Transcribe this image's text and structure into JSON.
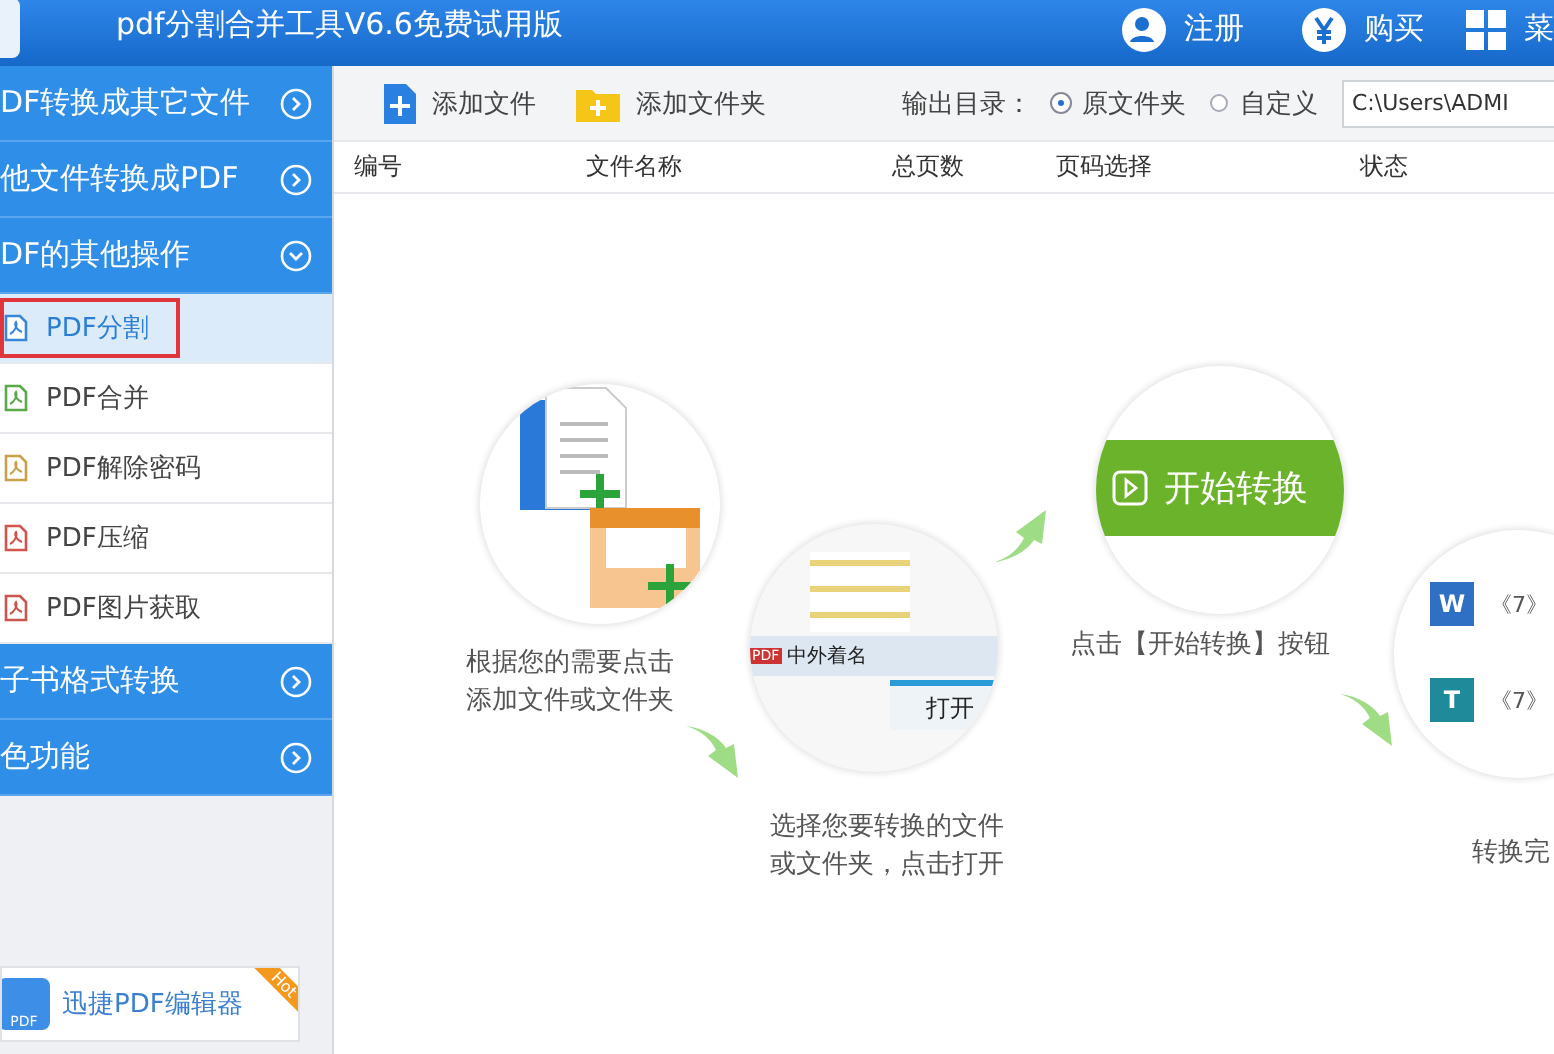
{
  "title_bar": {
    "title": "pdf分割合并工具V6.6免费试用版",
    "actions": [
      {
        "kind": "user",
        "label": "注册"
      },
      {
        "kind": "yen",
        "label": "购买"
      },
      {
        "kind": "grid",
        "label": "菜"
      }
    ]
  },
  "sidebar": {
    "groups": [
      {
        "label": "DF转换成其它文件",
        "expanded": false
      },
      {
        "label": "他文件转换成PDF",
        "expanded": false
      },
      {
        "label": "DF的其他操作",
        "expanded": true,
        "items": [
          {
            "label": "PDF分割",
            "selected": true,
            "color": "#3a86d6"
          },
          {
            "label": "PDF合并",
            "selected": false,
            "color": "#5aa84a"
          },
          {
            "label": "PDF解除密码",
            "selected": false,
            "color": "#c9a04a"
          },
          {
            "label": "PDF压缩",
            "selected": false,
            "color": "#d4544c"
          },
          {
            "label": "PDF图片获取",
            "selected": false,
            "color": "#c9554c"
          }
        ]
      },
      {
        "label": "子书格式转换",
        "expanded": false
      },
      {
        "label": "色功能",
        "expanded": false
      }
    ],
    "promo": {
      "logo_text": "PDF",
      "label": "迅捷PDF编辑器",
      "badge": "Hot"
    }
  },
  "toolbar": {
    "buttons": [
      {
        "kind": "file",
        "label": "添加文件"
      },
      {
        "kind": "folder",
        "label": "添加文件夹"
      }
    ],
    "output_label": "输出目录：",
    "options": [
      {
        "label": "原文件夹",
        "selected": true
      },
      {
        "label": "自定义",
        "selected": false
      }
    ],
    "path": "C:\\Users\\ADMI"
  },
  "table": {
    "columns": [
      "编号",
      "文件名称",
      "总页数",
      "页码选择",
      "状态"
    ]
  },
  "guide": {
    "step1": {
      "caption": [
        "根据您的需要点击",
        "添加文件或文件夹"
      ]
    },
    "step2": {
      "file_badge": "PDF",
      "file_name": "中外着名",
      "button": "打开",
      "caption": [
        "选择您要转换的文件",
        "或文件夹，点击打开"
      ]
    },
    "step3": {
      "button": "开始转换",
      "caption": "点击【开始转换】按钮"
    },
    "step4": {
      "rows": [
        {
          "letter": "W",
          "text": "《7》",
          "color": "#2f6fc4"
        },
        {
          "letter": "T",
          "text": "《7》",
          "color": "#1f8a9a"
        }
      ],
      "caption": "转换完"
    }
  }
}
